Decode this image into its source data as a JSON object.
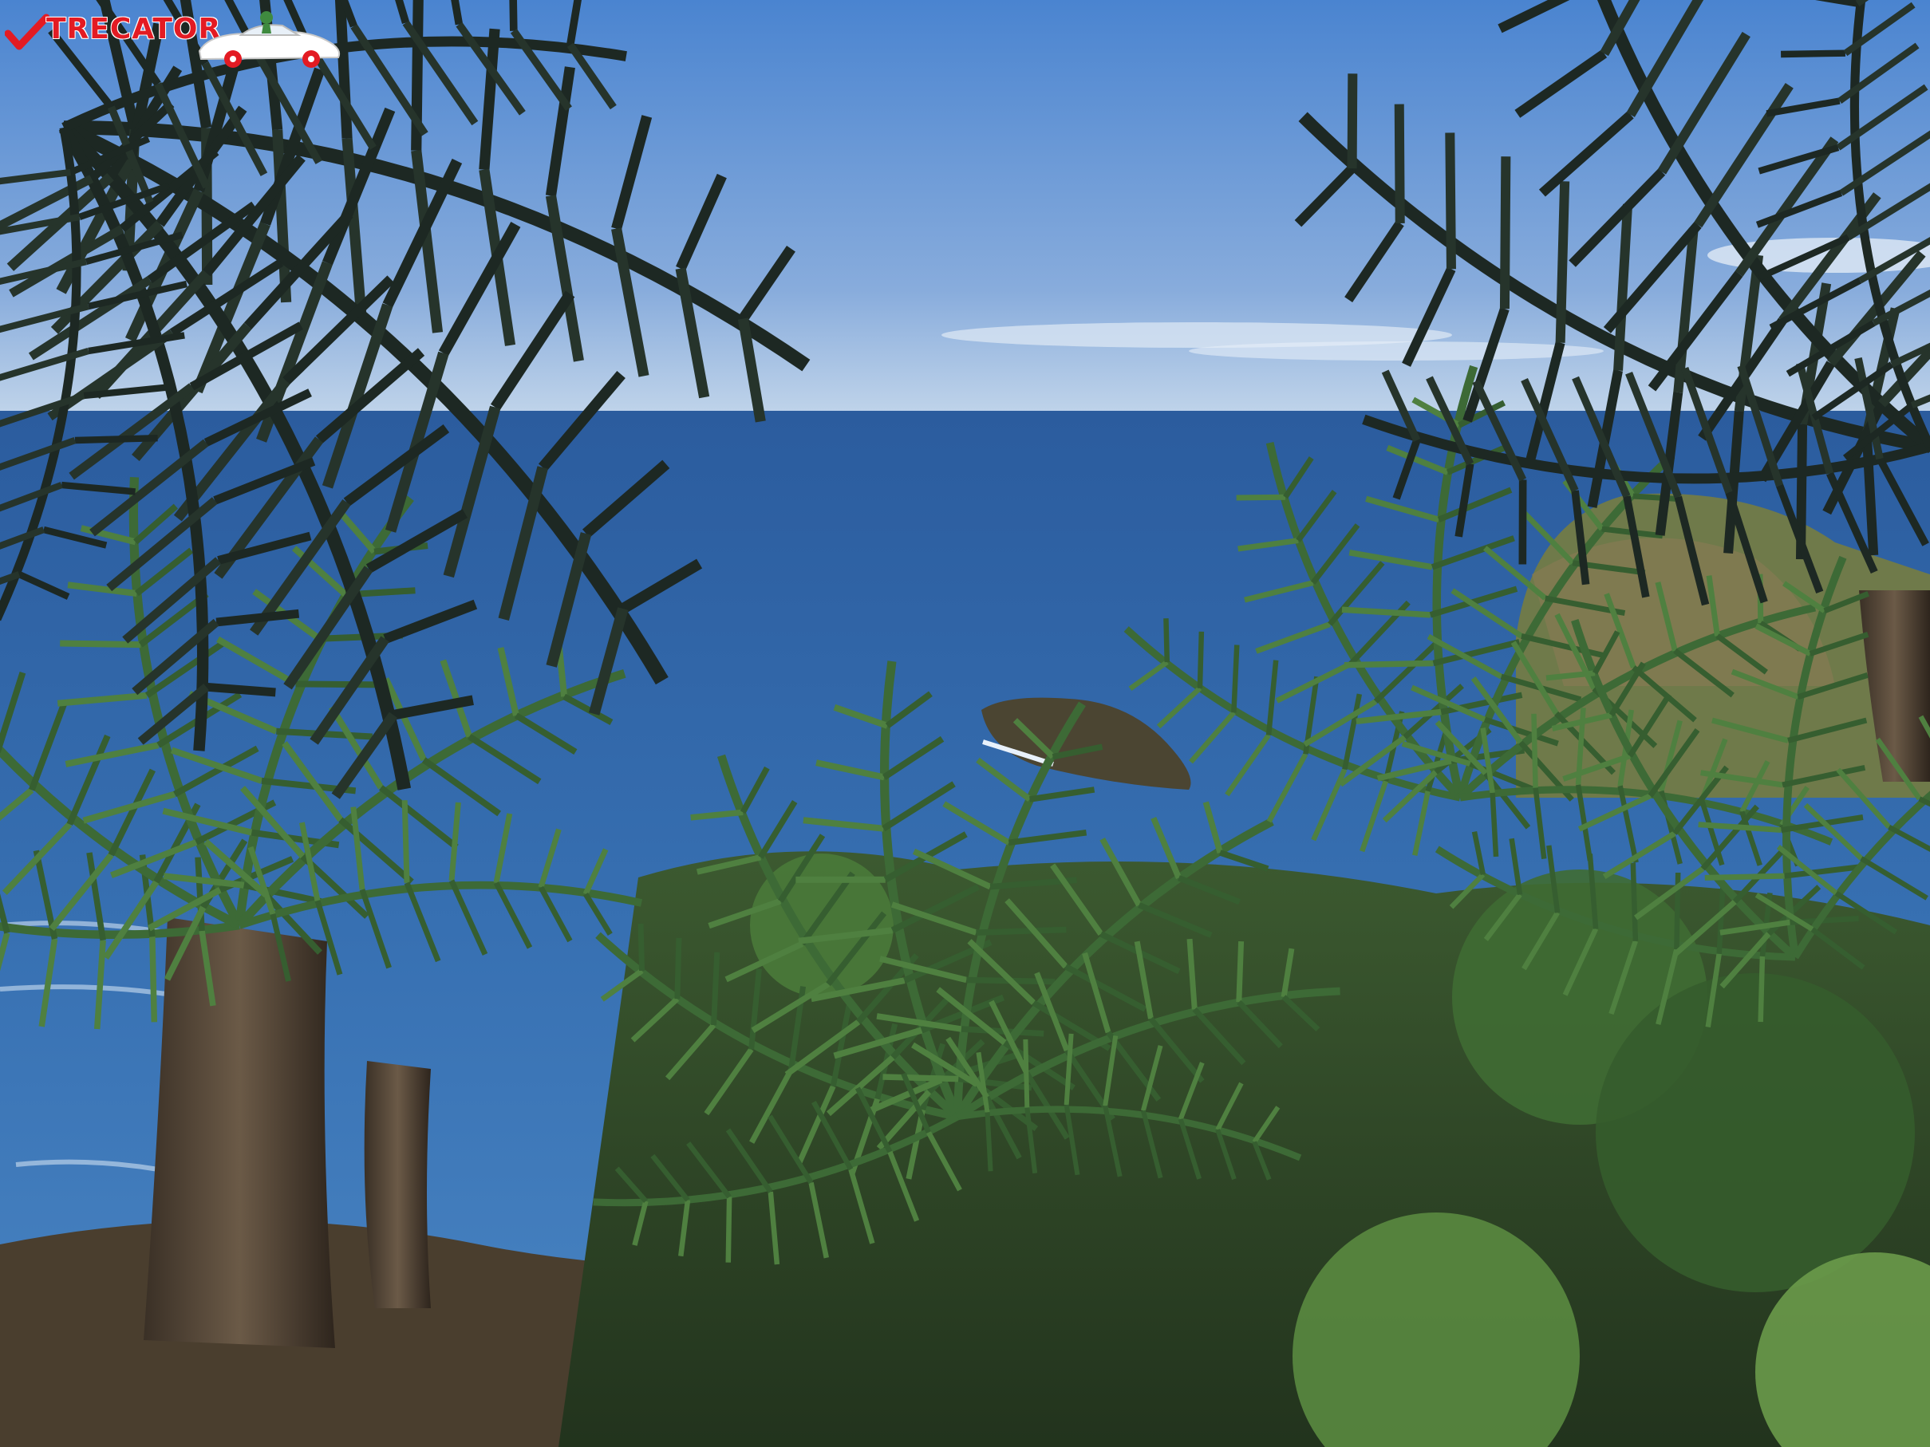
{
  "watermark": {
    "brand_text": "TRECATOR",
    "brand_color": "#e31b23"
  },
  "palette": {
    "sky_top": "#4d86d2",
    "sky_bottom": "#b9d0ea",
    "sea_far": "#2f62a5",
    "sea_near": "#3f7bbd",
    "frond_dark": "#1e2a24",
    "frond_green": "#3f6a37",
    "foliage": "#4a7a3a"
  },
  "icons": [
    "checkmark-icon",
    "car-icon"
  ]
}
